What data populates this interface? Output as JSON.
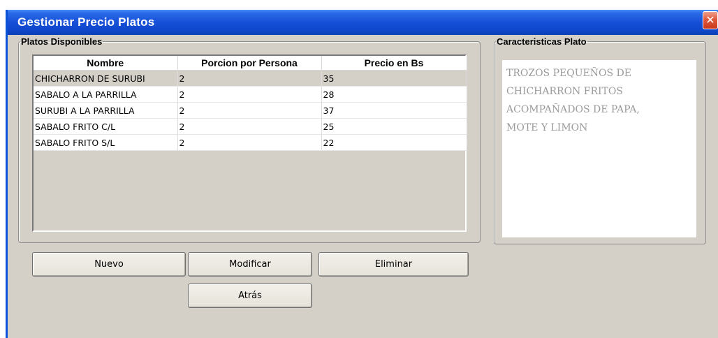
{
  "window": {
    "title": "Gestionar Precio Platos",
    "close_glyph": "✕"
  },
  "platos_group": {
    "legend": "Platos Disponibles",
    "columns": [
      "Nombre",
      "Porcion por Persona",
      "Precio en Bs"
    ],
    "rows": [
      [
        "CHICHARRON DE SURUBI",
        "2",
        "35"
      ],
      [
        "SABALO A LA PARRILLA",
        "2",
        "28"
      ],
      [
        "SURUBI A LA PARRILLA",
        "2",
        "37"
      ],
      [
        "SABALO FRITO C/L",
        "2",
        "25"
      ],
      [
        "SABALO FRITO S/L",
        "2",
        "22"
      ]
    ],
    "selected_row": 0
  },
  "caracteristicas_group": {
    "legend": "Caracteristicas Plato",
    "description_lines": [
      "TROZOS PEQUEÑOS DE",
      "CHICHARRON FRITOS",
      "ACOMPAÑADOS DE PAPA,",
      "MOTE Y LIMON"
    ]
  },
  "buttons": {
    "nuevo": "Nuevo",
    "modificar": "Modificar",
    "eliminar": "Eliminar",
    "atras": "Atrás"
  },
  "colors": {
    "titlebar": "#0e46c8",
    "panel_bg": "#d4d0c8",
    "close_button": "#e0583a",
    "description_text": "#9a9a9a"
  },
  "icons": {
    "close": "close-icon"
  }
}
